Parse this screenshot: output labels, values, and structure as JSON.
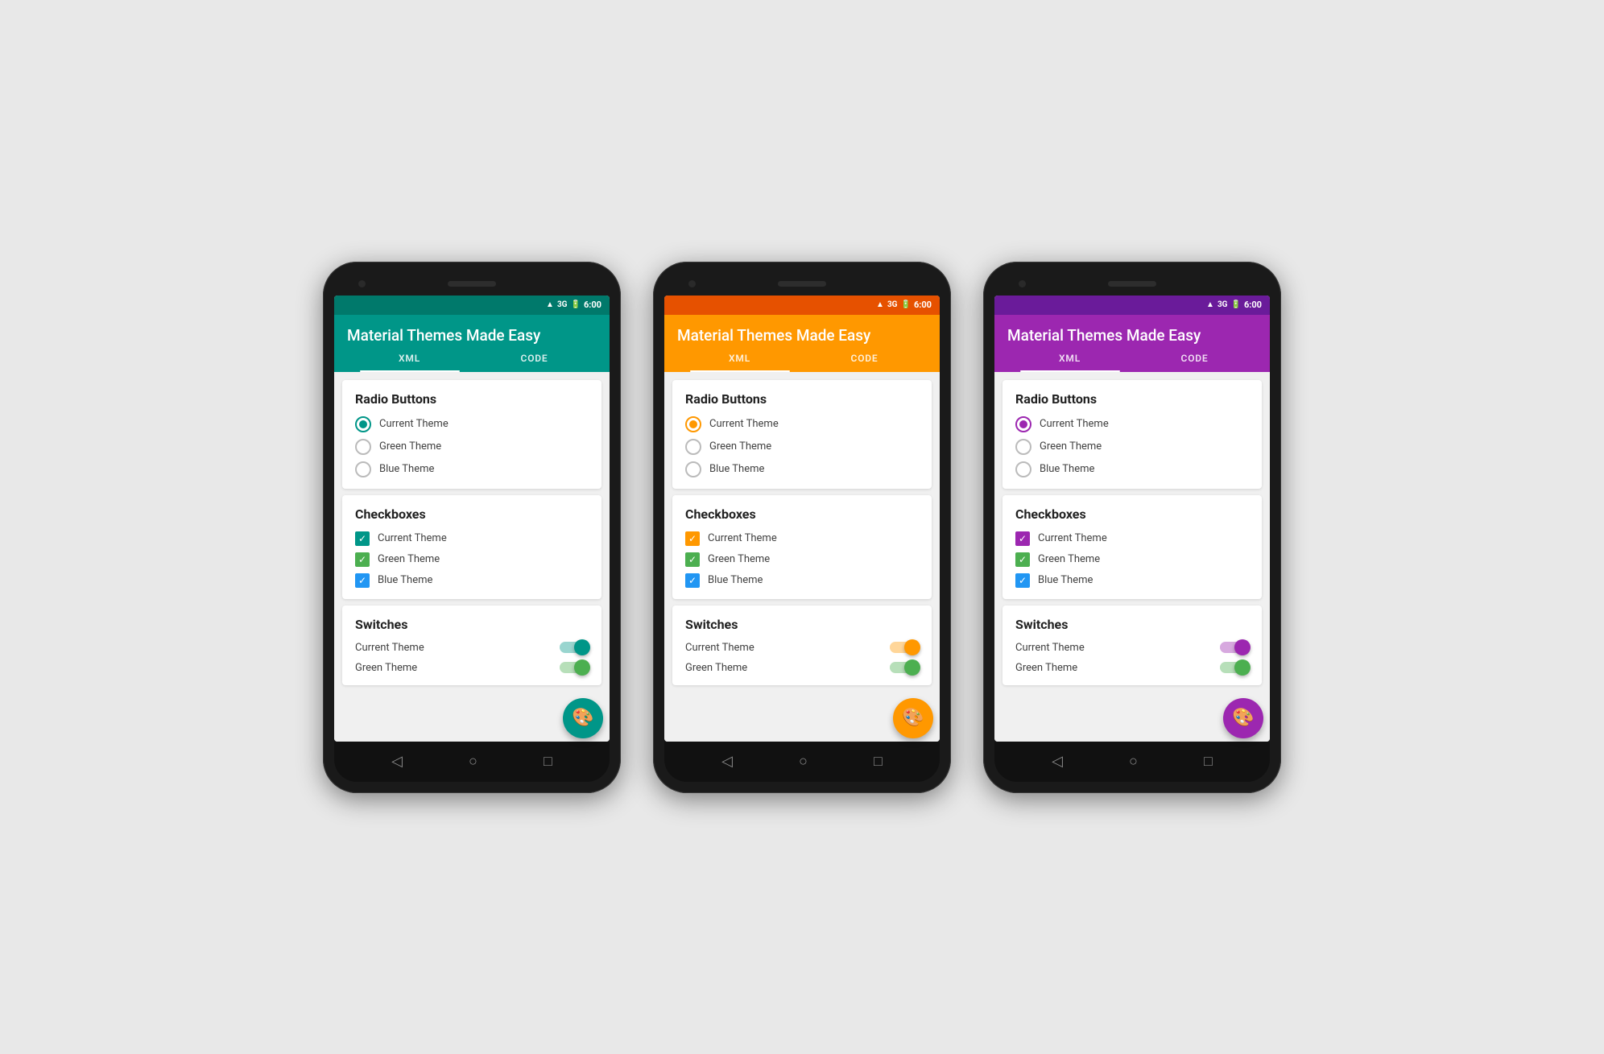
{
  "phones": [
    {
      "id": "teal-phone",
      "themeClass": "theme-teal",
      "themeColor": "#009688",
      "themeDarkColor": "#00796b",
      "statusBar": {
        "time": "6:00",
        "signal": "▲▼",
        "network": "3G",
        "battery": "■"
      },
      "appBar": {
        "title": "Material Themes Made Easy",
        "tabs": [
          "XML",
          "CODE"
        ]
      },
      "sections": [
        {
          "type": "radio",
          "title": "Radio Buttons",
          "items": [
            {
              "label": "Current Theme",
              "selected": true
            },
            {
              "label": "Green Theme",
              "selected": false
            },
            {
              "label": "Blue Theme",
              "selected": false
            }
          ]
        },
        {
          "type": "checkbox",
          "title": "Checkboxes",
          "items": [
            {
              "label": "Current Theme",
              "checked": true,
              "colorClass": "theme-color"
            },
            {
              "label": "Green Theme",
              "checked": true,
              "colorClass": "green"
            },
            {
              "label": "Blue Theme",
              "checked": true,
              "colorClass": "blue"
            }
          ]
        },
        {
          "type": "switch",
          "title": "Switches",
          "items": [
            {
              "label": "Current Theme",
              "on": true,
              "colorClass": "theme-color"
            },
            {
              "label": "Green Theme",
              "on": true,
              "colorClass": "green"
            }
          ]
        }
      ]
    },
    {
      "id": "orange-phone",
      "themeClass": "theme-orange",
      "themeColor": "#ff9800",
      "themeDarkColor": "#e65100",
      "statusBar": {
        "time": "6:00"
      },
      "appBar": {
        "title": "Material Themes Made Easy",
        "tabs": [
          "XML",
          "CODE"
        ]
      },
      "sections": [
        {
          "type": "radio",
          "title": "Radio Buttons",
          "items": [
            {
              "label": "Current Theme",
              "selected": true
            },
            {
              "label": "Green Theme",
              "selected": false
            },
            {
              "label": "Blue Theme",
              "selected": false
            }
          ]
        },
        {
          "type": "checkbox",
          "title": "Checkboxes",
          "items": [
            {
              "label": "Current Theme",
              "checked": true,
              "colorClass": "theme-color"
            },
            {
              "label": "Green Theme",
              "checked": true,
              "colorClass": "green"
            },
            {
              "label": "Blue Theme",
              "checked": true,
              "colorClass": "blue"
            }
          ]
        },
        {
          "type": "switch",
          "title": "Switches",
          "items": [
            {
              "label": "Current Theme",
              "on": true,
              "colorClass": "theme-color"
            },
            {
              "label": "Green Theme",
              "on": true,
              "colorClass": "green"
            }
          ]
        }
      ]
    },
    {
      "id": "purple-phone",
      "themeClass": "theme-purple",
      "themeColor": "#9c27b0",
      "themeDarkColor": "#6a1b9a",
      "statusBar": {
        "time": "6:00"
      },
      "appBar": {
        "title": "Material Themes Made Easy",
        "tabs": [
          "XML",
          "CODE"
        ]
      },
      "sections": [
        {
          "type": "radio",
          "title": "Radio Buttons",
          "items": [
            {
              "label": "Current Theme",
              "selected": true
            },
            {
              "label": "Green Theme",
              "selected": false
            },
            {
              "label": "Blue Theme",
              "selected": false
            }
          ]
        },
        {
          "type": "checkbox",
          "title": "Checkboxes",
          "items": [
            {
              "label": "Current Theme",
              "checked": true,
              "colorClass": "theme-color"
            },
            {
              "label": "Green Theme",
              "checked": true,
              "colorClass": "green"
            },
            {
              "label": "Blue Theme",
              "checked": true,
              "colorClass": "blue"
            }
          ]
        },
        {
          "type": "switch",
          "title": "Switches",
          "items": [
            {
              "label": "Current Theme",
              "on": true,
              "colorClass": "theme-color"
            },
            {
              "label": "Green Theme",
              "on": true,
              "colorClass": "green"
            }
          ]
        }
      ]
    }
  ],
  "nav": {
    "back": "◁",
    "home": "○",
    "recents": "□"
  },
  "fab": {
    "icon": "🎨"
  }
}
